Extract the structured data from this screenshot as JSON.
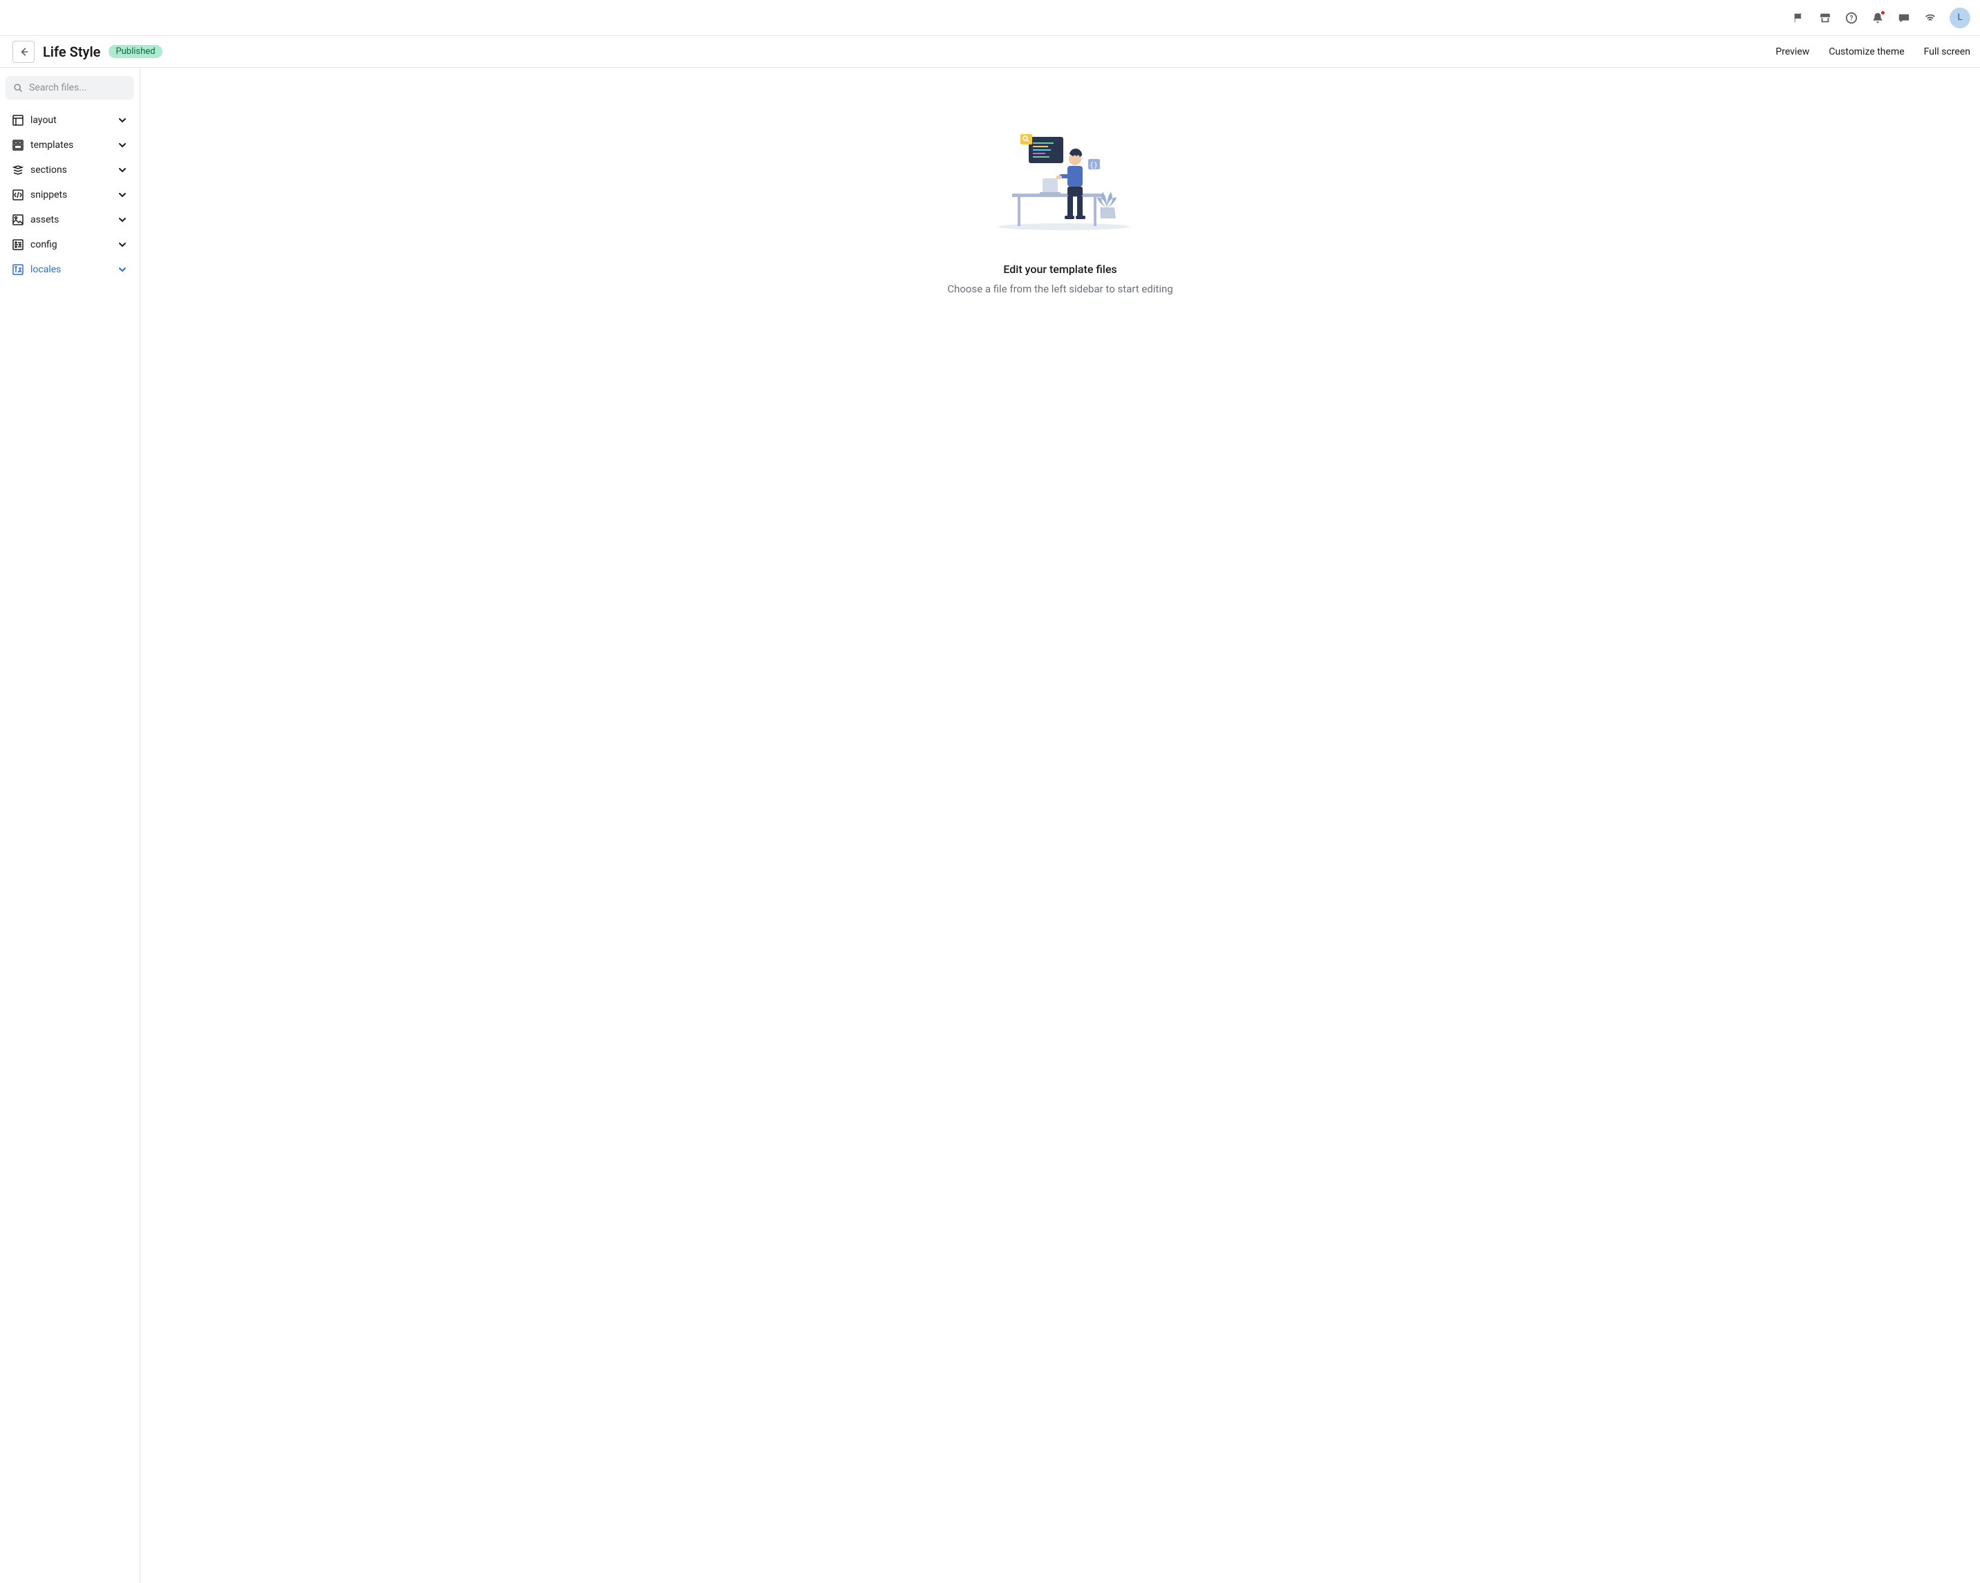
{
  "header": {
    "title": "Life Style",
    "status": "Published",
    "actions": {
      "preview": "Preview",
      "customize": "Customize theme",
      "fullscreen": "Full screen"
    }
  },
  "utility": {
    "avatar_initial": "L"
  },
  "sidebar": {
    "search_placeholder": "Search files...",
    "folders": [
      {
        "label": "layout"
      },
      {
        "label": "templates"
      },
      {
        "label": "sections"
      },
      {
        "label": "snippets"
      },
      {
        "label": "assets"
      },
      {
        "label": "config"
      },
      {
        "label": "locales"
      }
    ]
  },
  "main": {
    "empty_title": "Edit your template files",
    "empty_subtitle": "Choose a file from the left sidebar to start editing"
  }
}
